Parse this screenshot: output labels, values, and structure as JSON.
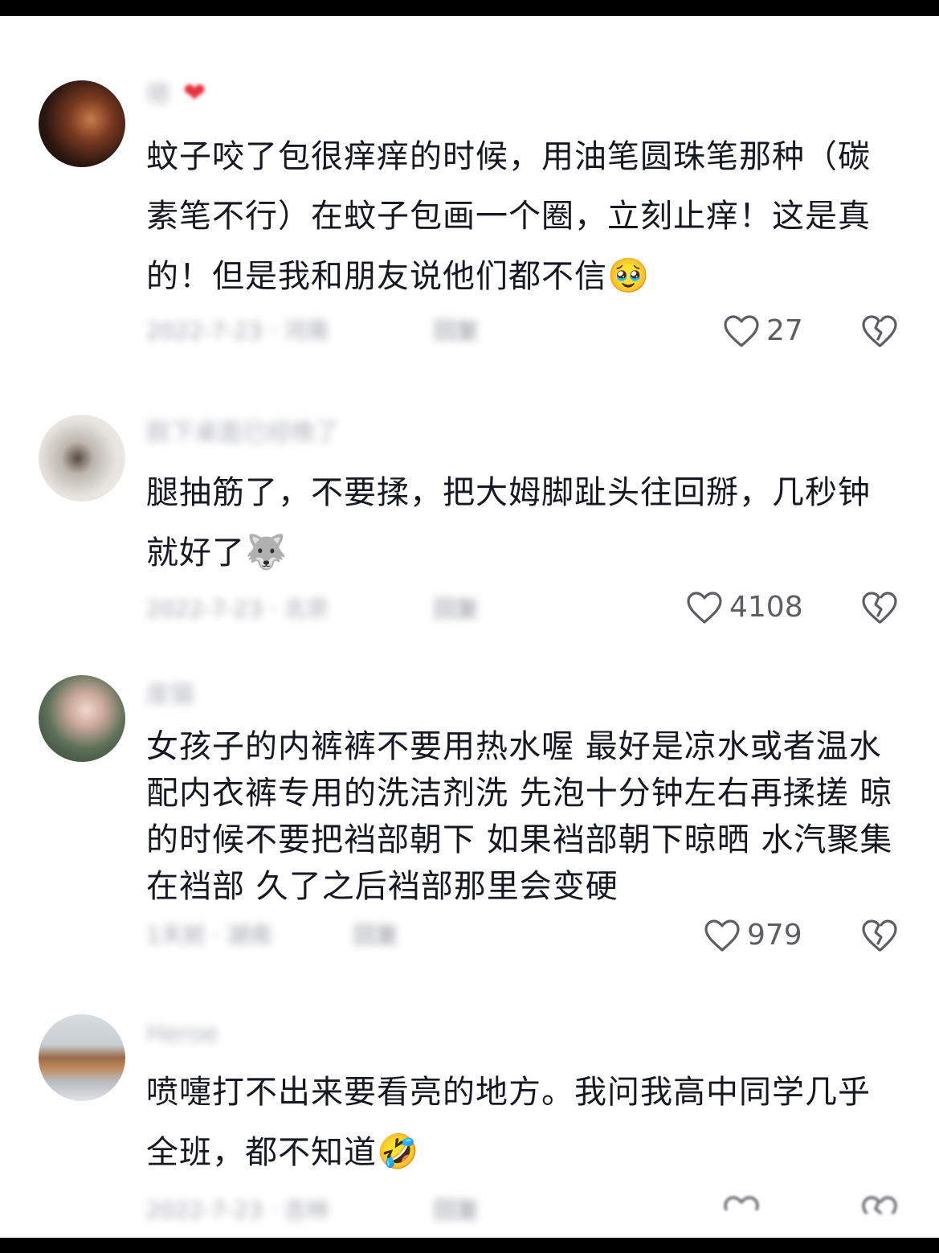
{
  "comments": [
    {
      "username": "嗯",
      "text": "蚊子咬了包很痒痒的时候，用油笔圆珠笔那种（碳素笔不行）在蚊子包画一个圈，立刻止痒！这是真的！但是我和朋友说他们都不信",
      "emoji": "🥹",
      "meta": "2022-7-23 · 河南",
      "reply": "回复",
      "likes": "27"
    },
    {
      "username": "脱下桌面已经晚了",
      "text": "腿抽筋了，不要揉，把大姆脚趾头往回掰，几秒钟就好了",
      "emoji": "🐺",
      "meta": "2022-7-23 · 北京",
      "reply": "回复",
      "likes": "4108"
    },
    {
      "username": "废猫",
      "text": "女孩子的内裤裤不要用热水喔 最好是凉水或者温水配内衣裤专用的洗洁剂洗 先泡十分钟左右再揉搓 晾的时候不要把裆部朝下 如果裆部朝下晾晒 水汽聚集在裆部 久了之后裆部那里会变硬",
      "emoji": "",
      "meta": "1天前 · 湖南",
      "reply": "回复",
      "likes": "979"
    },
    {
      "username": "Heroe",
      "text": "喷嚏打不出来要看亮的地方。我问我高中同学几乎全班，都不知道",
      "emoji": "🤣",
      "meta": "2022-7-23 · 吉林",
      "reply": "回复",
      "likes": ""
    }
  ],
  "colors": {
    "text": "#161823",
    "meta": "#a4a6ac",
    "count": "#5c5e64",
    "badge": "#e8323e"
  }
}
